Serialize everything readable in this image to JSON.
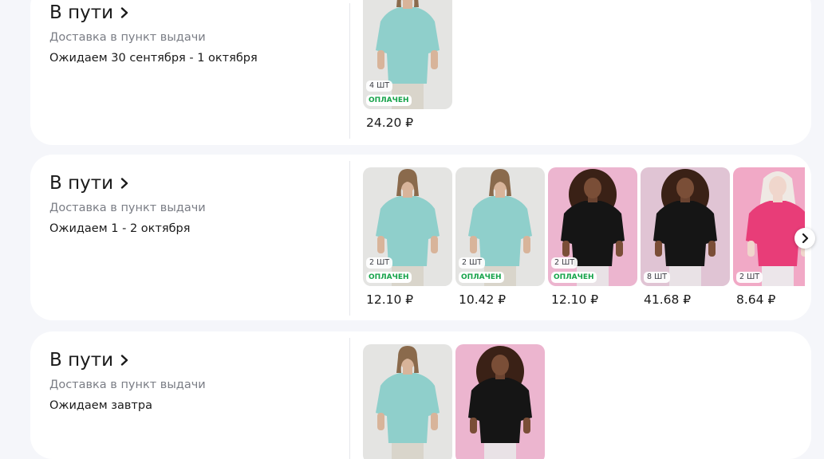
{
  "orders": [
    {
      "status": "В пути",
      "delivery_type": "Доставка в пункт выдачи",
      "expected": "Ожидаем 30 сентября - 1 октября",
      "items": [
        {
          "product": "mint-tshirt",
          "qty": "4 ШТ",
          "paid": "ОПЛАЧЕН",
          "price": "24.20 ₽"
        }
      ]
    },
    {
      "status": "В пути",
      "delivery_type": "Доставка в пункт выдачи",
      "expected": "Ожидаем 1 - 2 октября",
      "items": [
        {
          "product": "mint-tshirt",
          "qty": "2 ШТ",
          "paid": "ОПЛАЧЕН",
          "price": "12.10 ₽"
        },
        {
          "product": "mint-tshirt",
          "qty": "2 ШТ",
          "paid": "ОПЛАЧЕН",
          "price": "10.42 ₽"
        },
        {
          "product": "black-tshirt",
          "qty": "2 ШТ",
          "paid": "ОПЛАЧЕН",
          "price": "12.10 ₽"
        },
        {
          "product": "black-tshirt",
          "qty": "8 ШТ",
          "paid": "",
          "price": "41.68 ₽"
        },
        {
          "product": "pink-tshirt",
          "qty": "2 ШТ",
          "paid": "",
          "price": "8.64 ₽"
        }
      ]
    },
    {
      "status": "В пути",
      "delivery_type": "Доставка в пункт выдачи",
      "expected": "Ожидаем завтра",
      "items": [
        {
          "product": "mint-tshirt"
        },
        {
          "product": "black-tshirt"
        }
      ]
    }
  ],
  "icons": {
    "status_arrow": "chevron-right-icon",
    "carousel_next": "chevron-right-icon"
  },
  "colors": {
    "page_background": "#f5f6fa",
    "card_background": "#ffffff",
    "paid_badge_text": "#16a34a",
    "secondary_text": "#7a7d85"
  }
}
